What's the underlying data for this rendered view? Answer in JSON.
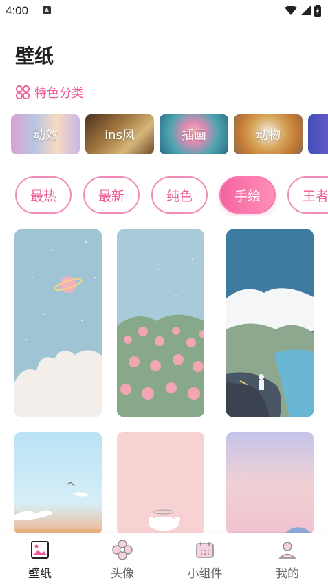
{
  "status_bar": {
    "time": "4:00",
    "indicator_letter": "A",
    "icons": [
      "wifi-icon",
      "signal-icon",
      "battery-icon"
    ]
  },
  "page": {
    "title": "壁纸"
  },
  "featured": {
    "title": "特色分类",
    "icon": "grid-flower-icon",
    "categories": [
      {
        "label": "动效"
      },
      {
        "label": "ins风"
      },
      {
        "label": "插画"
      },
      {
        "label": "动物"
      },
      {
        "label": ""
      }
    ]
  },
  "filters": {
    "chips": [
      "最热",
      "最新",
      "纯色",
      "手绘",
      "王者"
    ],
    "selected": "手绘"
  },
  "wallpapers": [
    {
      "theme": "planet-clouds"
    },
    {
      "theme": "pink-flowers"
    },
    {
      "theme": "coastal-road"
    },
    {
      "theme": "blue-sunset"
    },
    {
      "theme": "pink-angel"
    },
    {
      "theme": "purple-sky"
    }
  ],
  "bottom_nav": {
    "items": [
      {
        "label": "壁纸",
        "icon": "image-icon",
        "active": true
      },
      {
        "label": "头像",
        "icon": "avatar-flower-icon",
        "active": false
      },
      {
        "label": "小组件",
        "icon": "widget-calendar-icon",
        "active": false
      },
      {
        "label": "我的",
        "icon": "user-icon",
        "active": false
      }
    ]
  },
  "colors": {
    "accent": "#ef5a96",
    "active_chip_start": "#f4649f",
    "active_chip_end": "#ff8fb8",
    "text_primary": "#222222",
    "text_secondary": "#666666"
  }
}
